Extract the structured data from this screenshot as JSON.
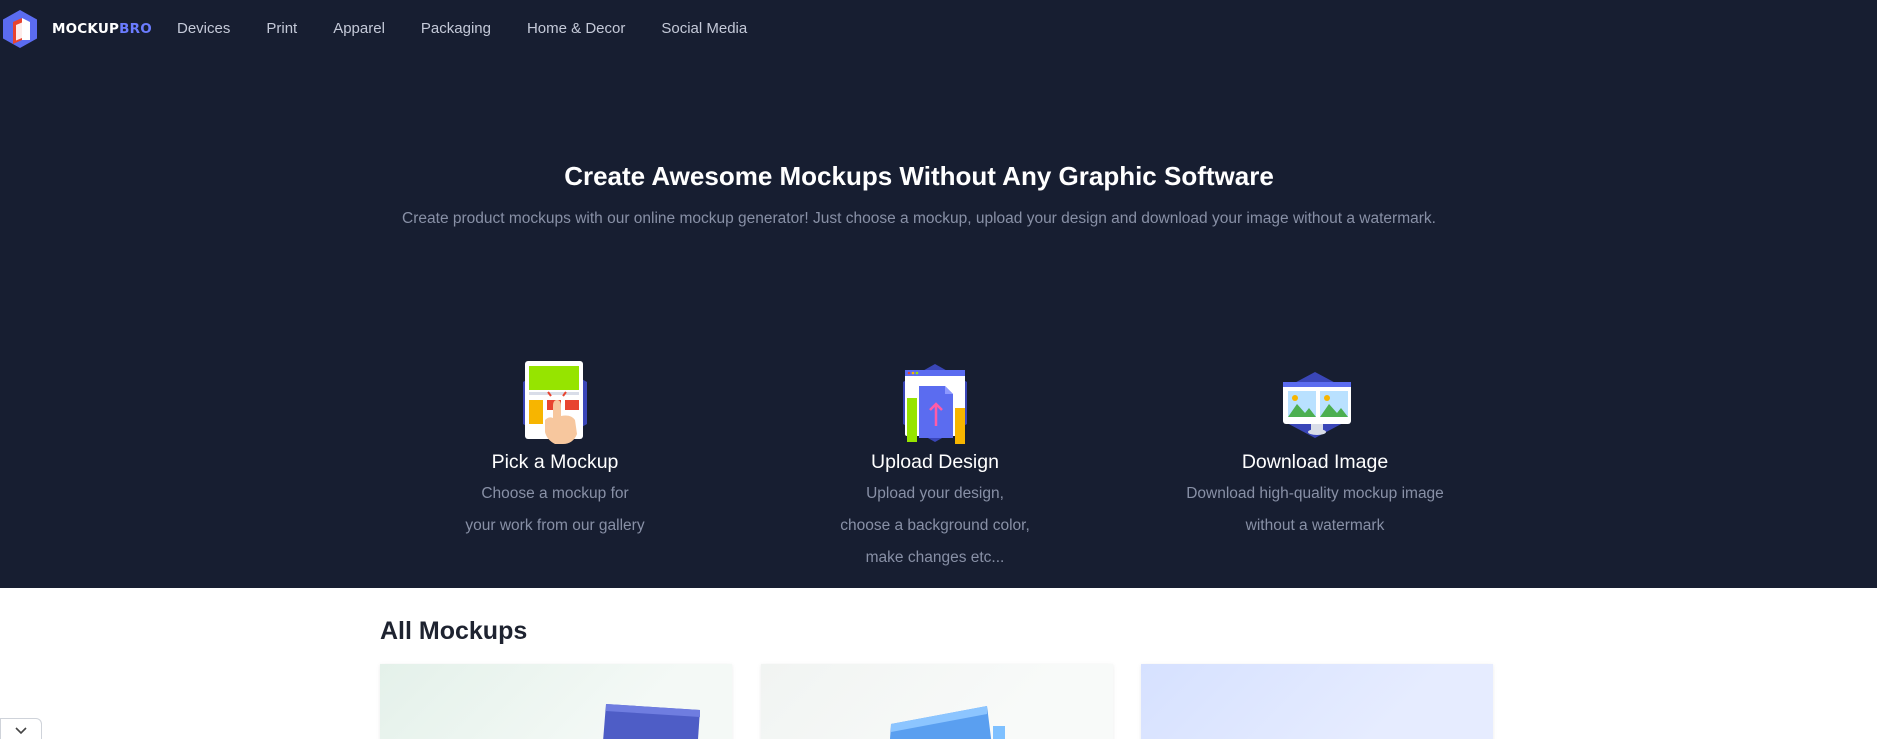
{
  "brand": {
    "name_main": "MOCKUP",
    "name_accent": "BRO"
  },
  "nav": {
    "items": [
      "Devices",
      "Print",
      "Apparel",
      "Packaging",
      "Home & Decor",
      "Social Media"
    ]
  },
  "hero": {
    "title": "Create Awesome Mockups Without Any Graphic Software",
    "subtitle": "Create product mockups with our online mockup generator! Just choose a mockup, upload your design and download your image without a watermark."
  },
  "steps": [
    {
      "title": "Pick a Mockup",
      "desc_lines": [
        "Choose a mockup for",
        "your work from our gallery"
      ]
    },
    {
      "title": "Upload Design",
      "desc_lines": [
        "Upload your design,",
        "choose a background color,",
        "make changes etc..."
      ]
    },
    {
      "title": "Download Image",
      "desc_lines": [
        "Download high-quality mockup image",
        "without a watermark"
      ]
    }
  ],
  "section": {
    "title": "All Mockups"
  },
  "colors": {
    "hero_bg": "#171e31",
    "accent": "#6b7cff",
    "muted_text": "#8890a6"
  },
  "icons": {
    "logo": "mockupbro-logo-icon",
    "collapse": "chevron-down-icon"
  }
}
